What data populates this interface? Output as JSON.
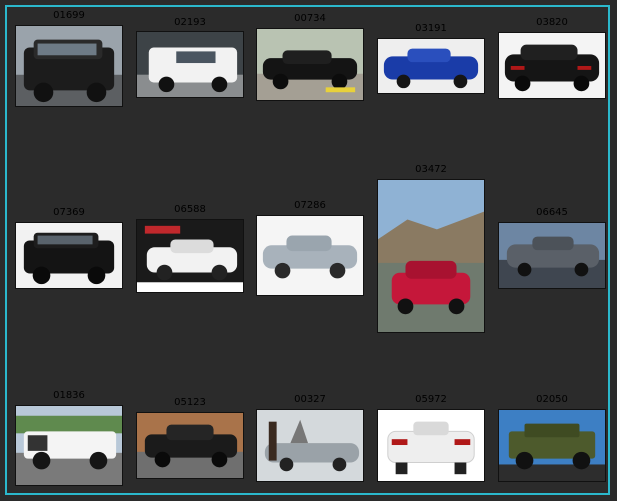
{
  "gallery": {
    "items": [
      {
        "id": "01699",
        "desc": "black-suv"
      },
      {
        "id": "02193",
        "desc": "white-minivan"
      },
      {
        "id": "00734",
        "desc": "black-sedan"
      },
      {
        "id": "03191",
        "desc": "blue-sedan"
      },
      {
        "id": "03820",
        "desc": "black-sedan-rear"
      },
      {
        "id": "07369",
        "desc": "black-suv-volvo"
      },
      {
        "id": "06588",
        "desc": "white-cadillac"
      },
      {
        "id": "07286",
        "desc": "silver-bmw"
      },
      {
        "id": "03472",
        "desc": "red-audi-mountains"
      },
      {
        "id": "06645",
        "desc": "gray-sedan"
      },
      {
        "id": "01836",
        "desc": "white-pickup"
      },
      {
        "id": "05123",
        "desc": "black-dodge"
      },
      {
        "id": "00327",
        "desc": "silver-concept-car"
      },
      {
        "id": "05972",
        "desc": "white-audi-rear"
      },
      {
        "id": "02050",
        "desc": "green-hummer"
      }
    ]
  },
  "colors": {
    "background": "#2b2b2b",
    "frame_border": "#2bb8cc",
    "caption_text": "#000000"
  }
}
